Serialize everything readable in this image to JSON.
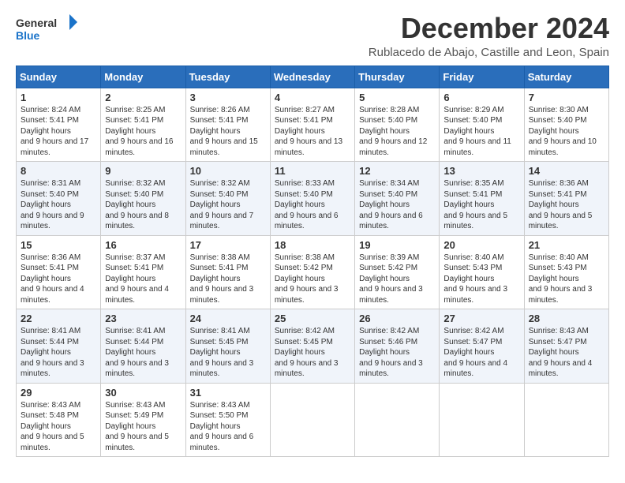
{
  "logo": {
    "line1": "General",
    "line2": "Blue"
  },
  "title": "December 2024",
  "subtitle": "Rublacedo de Abajo, Castille and Leon, Spain",
  "days_of_week": [
    "Sunday",
    "Monday",
    "Tuesday",
    "Wednesday",
    "Thursday",
    "Friday",
    "Saturday"
  ],
  "weeks": [
    [
      {
        "day": "1",
        "sunrise": "8:24 AM",
        "sunset": "5:41 PM",
        "daylight": "9 hours and 17 minutes."
      },
      {
        "day": "2",
        "sunrise": "8:25 AM",
        "sunset": "5:41 PM",
        "daylight": "9 hours and 16 minutes."
      },
      {
        "day": "3",
        "sunrise": "8:26 AM",
        "sunset": "5:41 PM",
        "daylight": "9 hours and 15 minutes."
      },
      {
        "day": "4",
        "sunrise": "8:27 AM",
        "sunset": "5:41 PM",
        "daylight": "9 hours and 13 minutes."
      },
      {
        "day": "5",
        "sunrise": "8:28 AM",
        "sunset": "5:40 PM",
        "daylight": "9 hours and 12 minutes."
      },
      {
        "day": "6",
        "sunrise": "8:29 AM",
        "sunset": "5:40 PM",
        "daylight": "9 hours and 11 minutes."
      },
      {
        "day": "7",
        "sunrise": "8:30 AM",
        "sunset": "5:40 PM",
        "daylight": "9 hours and 10 minutes."
      }
    ],
    [
      {
        "day": "8",
        "sunrise": "8:31 AM",
        "sunset": "5:40 PM",
        "daylight": "9 hours and 9 minutes."
      },
      {
        "day": "9",
        "sunrise": "8:32 AM",
        "sunset": "5:40 PM",
        "daylight": "9 hours and 8 minutes."
      },
      {
        "day": "10",
        "sunrise": "8:32 AM",
        "sunset": "5:40 PM",
        "daylight": "9 hours and 7 minutes."
      },
      {
        "day": "11",
        "sunrise": "8:33 AM",
        "sunset": "5:40 PM",
        "daylight": "9 hours and 6 minutes."
      },
      {
        "day": "12",
        "sunrise": "8:34 AM",
        "sunset": "5:40 PM",
        "daylight": "9 hours and 6 minutes."
      },
      {
        "day": "13",
        "sunrise": "8:35 AM",
        "sunset": "5:41 PM",
        "daylight": "9 hours and 5 minutes."
      },
      {
        "day": "14",
        "sunrise": "8:36 AM",
        "sunset": "5:41 PM",
        "daylight": "9 hours and 5 minutes."
      }
    ],
    [
      {
        "day": "15",
        "sunrise": "8:36 AM",
        "sunset": "5:41 PM",
        "daylight": "9 hours and 4 minutes."
      },
      {
        "day": "16",
        "sunrise": "8:37 AM",
        "sunset": "5:41 PM",
        "daylight": "9 hours and 4 minutes."
      },
      {
        "day": "17",
        "sunrise": "8:38 AM",
        "sunset": "5:41 PM",
        "daylight": "9 hours and 3 minutes."
      },
      {
        "day": "18",
        "sunrise": "8:38 AM",
        "sunset": "5:42 PM",
        "daylight": "9 hours and 3 minutes."
      },
      {
        "day": "19",
        "sunrise": "8:39 AM",
        "sunset": "5:42 PM",
        "daylight": "9 hours and 3 minutes."
      },
      {
        "day": "20",
        "sunrise": "8:40 AM",
        "sunset": "5:43 PM",
        "daylight": "9 hours and 3 minutes."
      },
      {
        "day": "21",
        "sunrise": "8:40 AM",
        "sunset": "5:43 PM",
        "daylight": "9 hours and 3 minutes."
      }
    ],
    [
      {
        "day": "22",
        "sunrise": "8:41 AM",
        "sunset": "5:44 PM",
        "daylight": "9 hours and 3 minutes."
      },
      {
        "day": "23",
        "sunrise": "8:41 AM",
        "sunset": "5:44 PM",
        "daylight": "9 hours and 3 minutes."
      },
      {
        "day": "24",
        "sunrise": "8:41 AM",
        "sunset": "5:45 PM",
        "daylight": "9 hours and 3 minutes."
      },
      {
        "day": "25",
        "sunrise": "8:42 AM",
        "sunset": "5:45 PM",
        "daylight": "9 hours and 3 minutes."
      },
      {
        "day": "26",
        "sunrise": "8:42 AM",
        "sunset": "5:46 PM",
        "daylight": "9 hours and 3 minutes."
      },
      {
        "day": "27",
        "sunrise": "8:42 AM",
        "sunset": "5:47 PM",
        "daylight": "9 hours and 4 minutes."
      },
      {
        "day": "28",
        "sunrise": "8:43 AM",
        "sunset": "5:47 PM",
        "daylight": "9 hours and 4 minutes."
      }
    ],
    [
      {
        "day": "29",
        "sunrise": "8:43 AM",
        "sunset": "5:48 PM",
        "daylight": "9 hours and 5 minutes."
      },
      {
        "day": "30",
        "sunrise": "8:43 AM",
        "sunset": "5:49 PM",
        "daylight": "9 hours and 5 minutes."
      },
      {
        "day": "31",
        "sunrise": "8:43 AM",
        "sunset": "5:50 PM",
        "daylight": "9 hours and 6 minutes."
      },
      null,
      null,
      null,
      null
    ]
  ]
}
